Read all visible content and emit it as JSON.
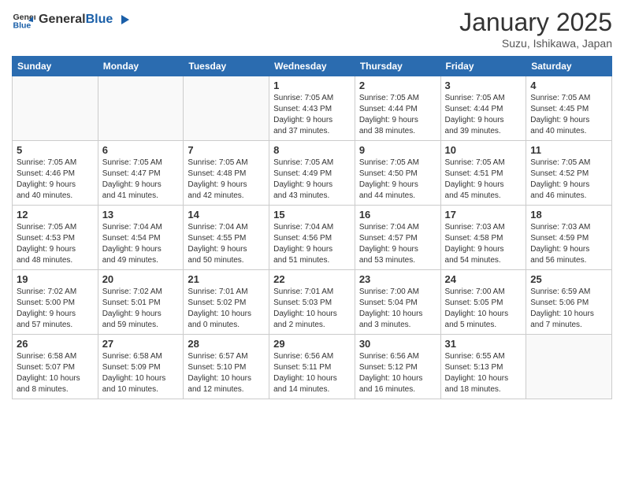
{
  "header": {
    "logo_general": "General",
    "logo_blue": "Blue",
    "month_title": "January 2025",
    "subtitle": "Suzu, Ishikawa, Japan"
  },
  "weekdays": [
    "Sunday",
    "Monday",
    "Tuesday",
    "Wednesday",
    "Thursday",
    "Friday",
    "Saturday"
  ],
  "weeks": [
    [
      {
        "day": "",
        "info": ""
      },
      {
        "day": "",
        "info": ""
      },
      {
        "day": "",
        "info": ""
      },
      {
        "day": "1",
        "info": "Sunrise: 7:05 AM\nSunset: 4:43 PM\nDaylight: 9 hours\nand 37 minutes."
      },
      {
        "day": "2",
        "info": "Sunrise: 7:05 AM\nSunset: 4:44 PM\nDaylight: 9 hours\nand 38 minutes."
      },
      {
        "day": "3",
        "info": "Sunrise: 7:05 AM\nSunset: 4:44 PM\nDaylight: 9 hours\nand 39 minutes."
      },
      {
        "day": "4",
        "info": "Sunrise: 7:05 AM\nSunset: 4:45 PM\nDaylight: 9 hours\nand 40 minutes."
      }
    ],
    [
      {
        "day": "5",
        "info": "Sunrise: 7:05 AM\nSunset: 4:46 PM\nDaylight: 9 hours\nand 40 minutes."
      },
      {
        "day": "6",
        "info": "Sunrise: 7:05 AM\nSunset: 4:47 PM\nDaylight: 9 hours\nand 41 minutes."
      },
      {
        "day": "7",
        "info": "Sunrise: 7:05 AM\nSunset: 4:48 PM\nDaylight: 9 hours\nand 42 minutes."
      },
      {
        "day": "8",
        "info": "Sunrise: 7:05 AM\nSunset: 4:49 PM\nDaylight: 9 hours\nand 43 minutes."
      },
      {
        "day": "9",
        "info": "Sunrise: 7:05 AM\nSunset: 4:50 PM\nDaylight: 9 hours\nand 44 minutes."
      },
      {
        "day": "10",
        "info": "Sunrise: 7:05 AM\nSunset: 4:51 PM\nDaylight: 9 hours\nand 45 minutes."
      },
      {
        "day": "11",
        "info": "Sunrise: 7:05 AM\nSunset: 4:52 PM\nDaylight: 9 hours\nand 46 minutes."
      }
    ],
    [
      {
        "day": "12",
        "info": "Sunrise: 7:05 AM\nSunset: 4:53 PM\nDaylight: 9 hours\nand 48 minutes."
      },
      {
        "day": "13",
        "info": "Sunrise: 7:04 AM\nSunset: 4:54 PM\nDaylight: 9 hours\nand 49 minutes."
      },
      {
        "day": "14",
        "info": "Sunrise: 7:04 AM\nSunset: 4:55 PM\nDaylight: 9 hours\nand 50 minutes."
      },
      {
        "day": "15",
        "info": "Sunrise: 7:04 AM\nSunset: 4:56 PM\nDaylight: 9 hours\nand 51 minutes."
      },
      {
        "day": "16",
        "info": "Sunrise: 7:04 AM\nSunset: 4:57 PM\nDaylight: 9 hours\nand 53 minutes."
      },
      {
        "day": "17",
        "info": "Sunrise: 7:03 AM\nSunset: 4:58 PM\nDaylight: 9 hours\nand 54 minutes."
      },
      {
        "day": "18",
        "info": "Sunrise: 7:03 AM\nSunset: 4:59 PM\nDaylight: 9 hours\nand 56 minutes."
      }
    ],
    [
      {
        "day": "19",
        "info": "Sunrise: 7:02 AM\nSunset: 5:00 PM\nDaylight: 9 hours\nand 57 minutes."
      },
      {
        "day": "20",
        "info": "Sunrise: 7:02 AM\nSunset: 5:01 PM\nDaylight: 9 hours\nand 59 minutes."
      },
      {
        "day": "21",
        "info": "Sunrise: 7:01 AM\nSunset: 5:02 PM\nDaylight: 10 hours\nand 0 minutes."
      },
      {
        "day": "22",
        "info": "Sunrise: 7:01 AM\nSunset: 5:03 PM\nDaylight: 10 hours\nand 2 minutes."
      },
      {
        "day": "23",
        "info": "Sunrise: 7:00 AM\nSunset: 5:04 PM\nDaylight: 10 hours\nand 3 minutes."
      },
      {
        "day": "24",
        "info": "Sunrise: 7:00 AM\nSunset: 5:05 PM\nDaylight: 10 hours\nand 5 minutes."
      },
      {
        "day": "25",
        "info": "Sunrise: 6:59 AM\nSunset: 5:06 PM\nDaylight: 10 hours\nand 7 minutes."
      }
    ],
    [
      {
        "day": "26",
        "info": "Sunrise: 6:58 AM\nSunset: 5:07 PM\nDaylight: 10 hours\nand 8 minutes."
      },
      {
        "day": "27",
        "info": "Sunrise: 6:58 AM\nSunset: 5:09 PM\nDaylight: 10 hours\nand 10 minutes."
      },
      {
        "day": "28",
        "info": "Sunrise: 6:57 AM\nSunset: 5:10 PM\nDaylight: 10 hours\nand 12 minutes."
      },
      {
        "day": "29",
        "info": "Sunrise: 6:56 AM\nSunset: 5:11 PM\nDaylight: 10 hours\nand 14 minutes."
      },
      {
        "day": "30",
        "info": "Sunrise: 6:56 AM\nSunset: 5:12 PM\nDaylight: 10 hours\nand 16 minutes."
      },
      {
        "day": "31",
        "info": "Sunrise: 6:55 AM\nSunset: 5:13 PM\nDaylight: 10 hours\nand 18 minutes."
      },
      {
        "day": "",
        "info": ""
      }
    ]
  ]
}
